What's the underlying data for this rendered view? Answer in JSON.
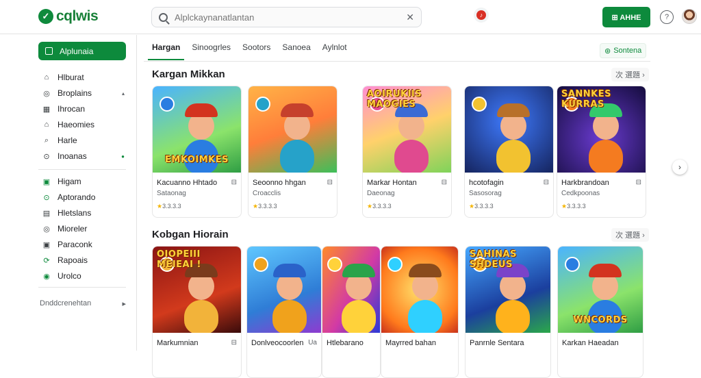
{
  "app": {
    "logo_mark": "✓",
    "logo_text": "cqlwis"
  },
  "search": {
    "placeholder": "Alplckaynanatlantan",
    "icon": "search-icon",
    "clear_icon": "close-icon"
  },
  "header": {
    "notification_icon": "bell-icon",
    "action_label": "⊞ AHHE",
    "help_label": "?",
    "avatar": "user-avatar"
  },
  "sidebar": {
    "primary": {
      "label": "Alplunaia",
      "icon": "home-icon"
    },
    "group1": [
      {
        "label": "Hlburat",
        "icon": "⌂"
      },
      {
        "label": "Broplains",
        "icon": "◎",
        "mark": "▴"
      },
      {
        "label": "Ihrocan",
        "icon": "▦"
      },
      {
        "label": "Haeomies",
        "icon": "⌂"
      },
      {
        "label": "Harle",
        "icon": "⌕"
      },
      {
        "label": "Inoanas",
        "icon": "⊙",
        "mark": "●",
        "mark_green": true
      }
    ],
    "group2": [
      {
        "label": "Higam",
        "icon": "▣",
        "green": true
      },
      {
        "label": "Aptorando",
        "icon": "⊙",
        "green": true
      },
      {
        "label": "Hletslans",
        "icon": "▤"
      },
      {
        "label": "Mioreler",
        "icon": "◎"
      },
      {
        "label": "Paraconk",
        "icon": "▣"
      },
      {
        "label": "Rapoais",
        "icon": "⟳",
        "green": true
      },
      {
        "label": "Urolco",
        "icon": "◉",
        "green": true
      }
    ],
    "footer_label": "Dnddcrenehtan",
    "footer_mark": "▸"
  },
  "tabs": {
    "items": [
      "Hargan",
      "Sinoogrles",
      "Sootors",
      "Sanoea",
      "Aylnlot"
    ],
    "active_index": 0,
    "action_label": "Sontena"
  },
  "sections": [
    {
      "title": "Kargan Mikkan",
      "more_label": "次 選題 ›",
      "cards": [
        {
          "title": "Kacuanno Hhtado",
          "meta": "⊟",
          "sub": "Sataonag",
          "rating": "3.3.3.3",
          "banner": "EMKOIMKES"
        },
        {
          "title": "Seoonno hhgan",
          "meta": "⊟",
          "sub": "Croacclis",
          "rating": "3.3.3.3",
          "banner": ""
        },
        {
          "title": "Markar Hontan",
          "meta": "⊟",
          "sub": "Daeonag",
          "rating": "3.3.3.3",
          "banner": "AOIRUKIIS MAOGIES"
        },
        {
          "title": "hcotofagin",
          "meta": "⊟",
          "sub": "Sasosorag",
          "rating": "3.3.3.3",
          "banner": ""
        },
        {
          "title": "Harkbrandoan",
          "meta": "⊟",
          "sub": "Cedkpoonas",
          "rating": "3.3.3.3",
          "banner": "SANNKES KURRAS"
        }
      ]
    },
    {
      "title": "Kobgan Hiorain",
      "more_label": "次 選題 ›",
      "cards": [
        {
          "title": "Markumnian",
          "meta": "⊟",
          "banner": "OIOPEIII MEIEAI !"
        },
        {
          "title": "Donlveocoorlen",
          "meta": "Ua",
          "banner": ""
        },
        {
          "title": "Htlebarano",
          "meta": "",
          "banner": ""
        },
        {
          "title": "Mayrred bahan",
          "meta": "",
          "banner": ""
        },
        {
          "title": "Panrnle Sentara",
          "meta": "",
          "banner": "SAHINAS SHDEUS"
        },
        {
          "title": "Karkan Haeadan",
          "meta": "",
          "banner": "WNCORDS"
        }
      ]
    }
  ],
  "colors": {
    "brand_green": "#0d8a3c",
    "rating_star": "#f4b400"
  }
}
